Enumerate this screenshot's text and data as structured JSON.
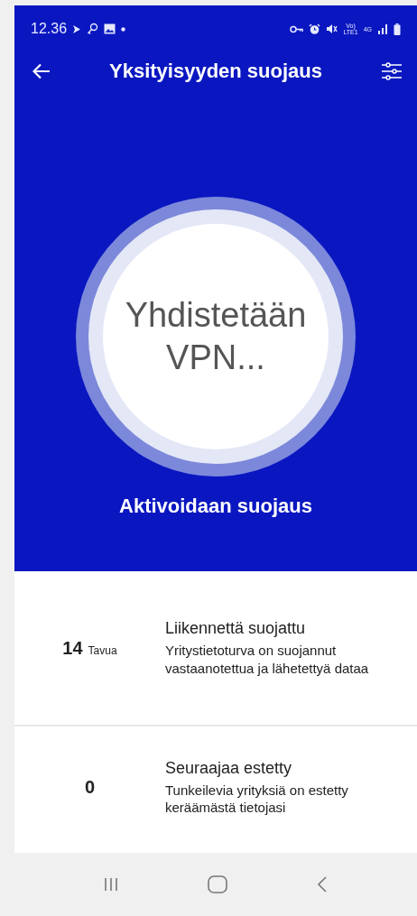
{
  "status_bar": {
    "time": "12.36",
    "network_labels": [
      "Vo)\nLTE1",
      "4G"
    ]
  },
  "header": {
    "title": "Yksityisyyden suojaus"
  },
  "status_circle": {
    "text": "Yhdistetään VPN..."
  },
  "status_caption": "Aktivoidaan suojaus",
  "stats": [
    {
      "value": "14",
      "unit": "Tavua",
      "title": "Liikennettä suojattu",
      "description": "Yritystietoturva on suojannut vastaanotettua ja lähetettyä dataa"
    },
    {
      "value": "0",
      "title": "Seuraajaa estetty",
      "description": "Tunkeilevia yrityksiä on estetty keräämästä tietojasi"
    }
  ]
}
